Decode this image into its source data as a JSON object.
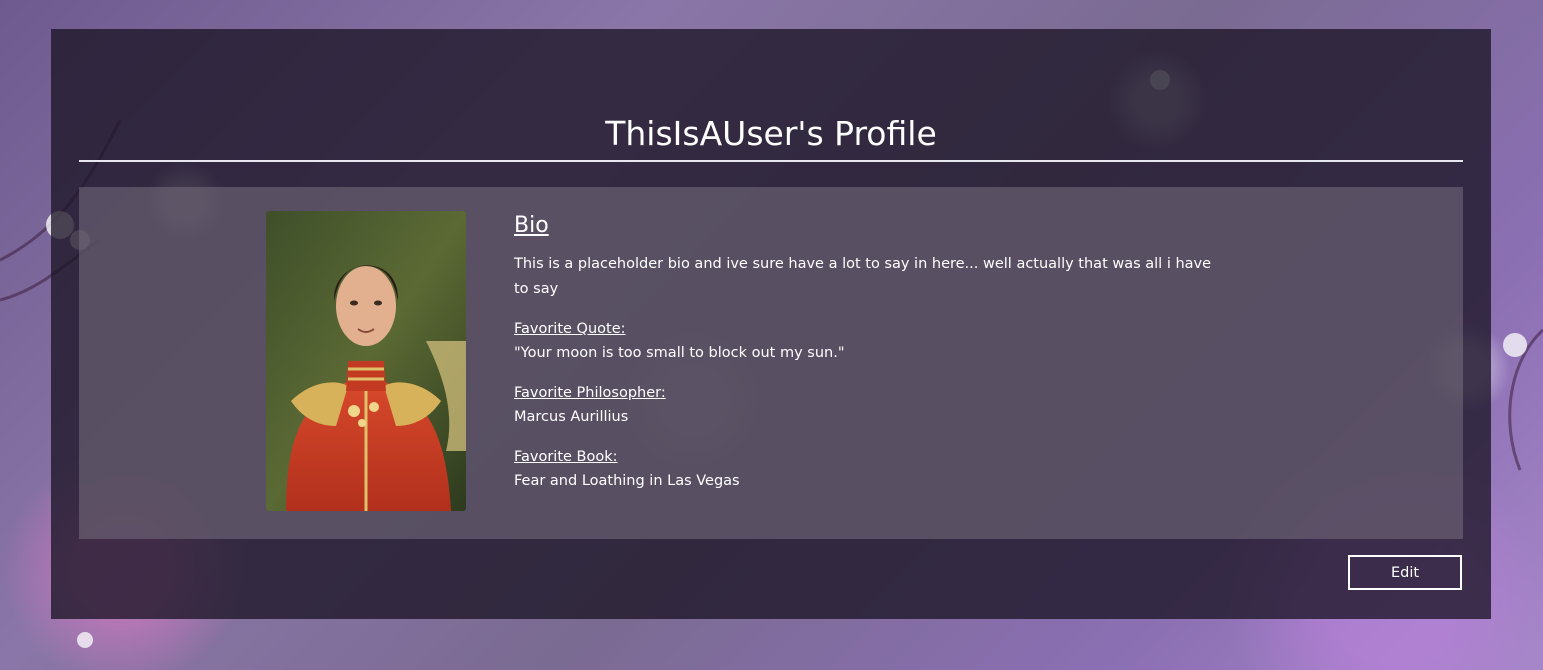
{
  "profile": {
    "title": "ThisIsAUser's Profile",
    "portrait_alt": "profile picture"
  },
  "bio": {
    "heading": "Bio",
    "text": "This is a placeholder bio and ive sure have a lot to say in here... well actually that was all i have to say"
  },
  "favorites": {
    "quote_label": "Favorite Quote:",
    "quote_value": "\"Your moon is too small to block out my sun.\"",
    "philosopher_label": "Favorite Philosopher:",
    "philosopher_value": "Marcus Aurillius",
    "book_label": "Favorite Book:",
    "book_value": "Fear and Loathing in Las Vegas"
  },
  "actions": {
    "edit_label": "Edit"
  },
  "colors": {
    "panel": "#1c1626",
    "text": "#ffffff",
    "accent": "#8b6fb3"
  }
}
